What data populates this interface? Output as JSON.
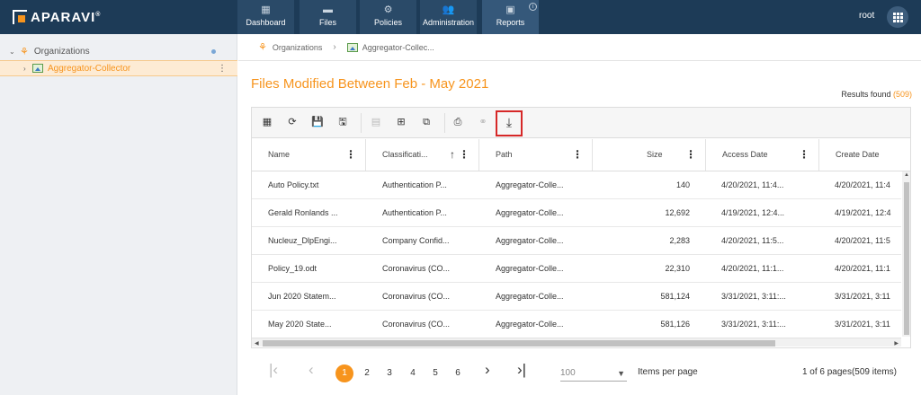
{
  "brand": {
    "name": "APARAVI",
    "reg": "®"
  },
  "nav": [
    {
      "label": "Dashboard",
      "icon": "dashboard-icon",
      "glyph": "▦"
    },
    {
      "label": "Files",
      "icon": "folder-icon",
      "glyph": "▬"
    },
    {
      "label": "Policies",
      "icon": "gear-icon",
      "glyph": "⚙"
    },
    {
      "label": "Administration",
      "icon": "users-icon",
      "glyph": "👥"
    },
    {
      "label": "Reports",
      "icon": "clipboard-icon",
      "glyph": "▣"
    }
  ],
  "active_nav": "Reports",
  "info_glyph": "i",
  "user": {
    "name": "root"
  },
  "sidebar": {
    "root_label": "Organizations",
    "child_label": "Aggregator-Collector",
    "caret_open": "⌄",
    "caret_closed": "›",
    "kebab": "⋮",
    "org_glyph": "⚘"
  },
  "breadcrumb": {
    "items": [
      "Organizations",
      "Aggregator-Collec..."
    ],
    "sep": "›",
    "org_glyph": "⚘"
  },
  "title": "Files Modified Between Feb - May 2021",
  "results": {
    "label": "Results found",
    "count": "(509)"
  },
  "toolbar": {
    "grid": "▦",
    "refresh": "⟳",
    "save": "💾",
    "save_as": "🖫",
    "col1": "▤",
    "col2": "⊞",
    "col3": "⧉",
    "print": "⎙",
    "link": "⚭",
    "download": "⤓"
  },
  "columns": {
    "name": "Name",
    "classification": "Classificati...",
    "path": "Path",
    "size": "Size",
    "access_date": "Access Date",
    "create_date": "Create Date",
    "kebab": "⋮",
    "sort_arrow": "↑"
  },
  "rows": [
    {
      "name": "Auto Policy.txt",
      "classification": "Authentication P...",
      "path": "Aggregator-Colle...",
      "size": "140",
      "access_date": "4/20/2021, 11:4...",
      "create_date": "4/20/2021, 11:4"
    },
    {
      "name": "Gerald Ronlands ...",
      "classification": "Authentication P...",
      "path": "Aggregator-Colle...",
      "size": "12,692",
      "access_date": "4/19/2021, 12:4...",
      "create_date": "4/19/2021, 12:4"
    },
    {
      "name": "Nucleuz_DlpEngi...",
      "classification": "Company Confid...",
      "path": "Aggregator-Colle...",
      "size": "2,283",
      "access_date": "4/20/2021, 11:5...",
      "create_date": "4/20/2021, 11:5"
    },
    {
      "name": "Policy_19.odt",
      "classification": "Coronavirus (CO...",
      "path": "Aggregator-Colle...",
      "size": "22,310",
      "access_date": "4/20/2021, 11:1...",
      "create_date": "4/20/2021, 11:1"
    },
    {
      "name": "Jun 2020 Statem...",
      "classification": "Coronavirus (CO...",
      "path": "Aggregator-Colle...",
      "size": "581,124",
      "access_date": "3/31/2021, 3:11:...",
      "create_date": "3/31/2021, 3:11"
    },
    {
      "name": "May 2020 State...",
      "classification": "Coronavirus (CO...",
      "path": "Aggregator-Colle...",
      "size": "581,126",
      "access_date": "3/31/2021, 3:11:...",
      "create_date": "3/31/2021, 3:11"
    }
  ],
  "scroll": {
    "up": "▲",
    "down": "▼",
    "left": "◀",
    "right": "▶"
  },
  "pager": {
    "first": "|‹",
    "prev": "‹",
    "next": "›",
    "last": "›|",
    "pages": [
      "1",
      "2",
      "3",
      "4",
      "5",
      "6"
    ],
    "current": "1",
    "per_page_value": "100",
    "per_page_caret": "▼",
    "per_page_label": "Items per page",
    "summary": "1 of 6 pages(509 items)"
  },
  "colors": {
    "accent": "#f7941d",
    "nav_bg": "#1d3b57",
    "highlight": "#d62828"
  }
}
